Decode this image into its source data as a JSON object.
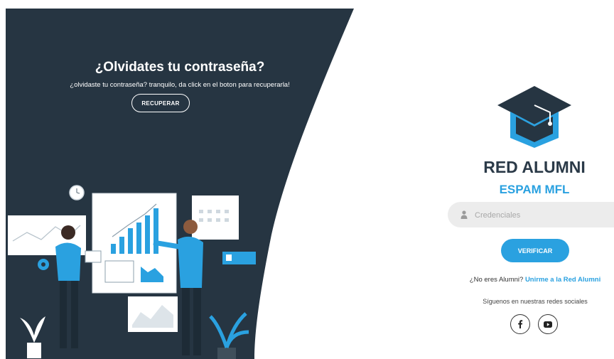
{
  "left_panel": {
    "headline": "¿Olvidates tu contraseña?",
    "subline": "¿olvidaste tu contraseña? tranquilo, da click en el boton para recuperarla!",
    "recover_label": "RECUPERAR",
    "background": "#263542"
  },
  "brand": {
    "title": "RED ALUMNI",
    "subtitle": "ESPAM MFL",
    "logo_icon": "graduation-cap-icon"
  },
  "login": {
    "credentials_placeholder": "Credenciales",
    "credentials_value": "",
    "user_icon": "user-icon",
    "verify_label": "VERIFICAR"
  },
  "join": {
    "question": "¿No eres Alumni?",
    "link_label": "Unirme a la Red Alumni"
  },
  "social": {
    "label": "Síguenos en nuestras redes sociales",
    "icons": [
      "facebook-icon",
      "youtube-icon"
    ]
  },
  "colors": {
    "accent": "#2aa1e0",
    "dark": "#263542",
    "title": "#2b3a48"
  }
}
